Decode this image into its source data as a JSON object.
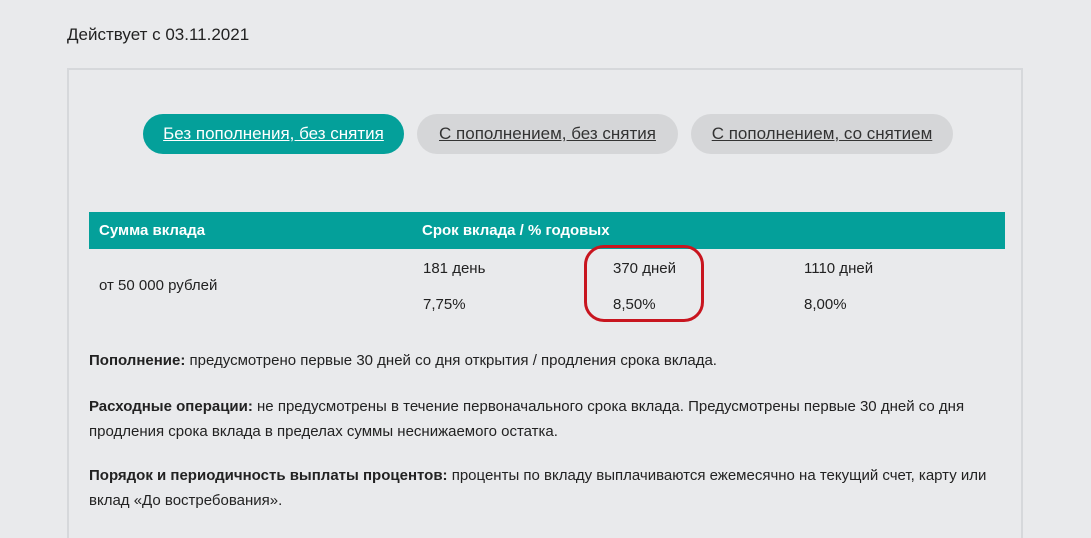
{
  "header": {
    "effective_date": "Действует с 03.11.2021"
  },
  "tabs": [
    {
      "label": "Без пополнения, без снятия",
      "active": true
    },
    {
      "label": "С пополнением, без снятия",
      "active": false
    },
    {
      "label": "С пополнением, со снятием",
      "active": false
    }
  ],
  "table": {
    "columns": {
      "amount": "Сумма вклада",
      "term": "Срок вклада / % годовых"
    },
    "row": {
      "amount": "от 50 000 рублей",
      "terms": [
        {
          "label": "181 день",
          "rate": "7,75%"
        },
        {
          "label": "370 дней",
          "rate": "8,50%"
        },
        {
          "label": "1110 дней",
          "rate": "8,00%"
        }
      ]
    }
  },
  "conditions": [
    {
      "title": "Пополнение:",
      "text": " предусмотрено первые 30 дней со дня открытия / продления срока вклада."
    },
    {
      "title": "Расходные операции:",
      "text": " не предусмотрены в течение первоначального срока вклада. Предусмотрены первые 30 дней со дня продления срока вклада в пределах суммы неснижаемого остатка."
    },
    {
      "title": "Порядок и периодичность выплаты процентов:",
      "text": " проценты по вкладу выплачиваются ежемесячно на текущий счет, карту или вклад «До востребования»."
    }
  ],
  "colors": {
    "accent": "#04a09a",
    "highlight": "#c8151f",
    "background": "#e9eaec"
  }
}
